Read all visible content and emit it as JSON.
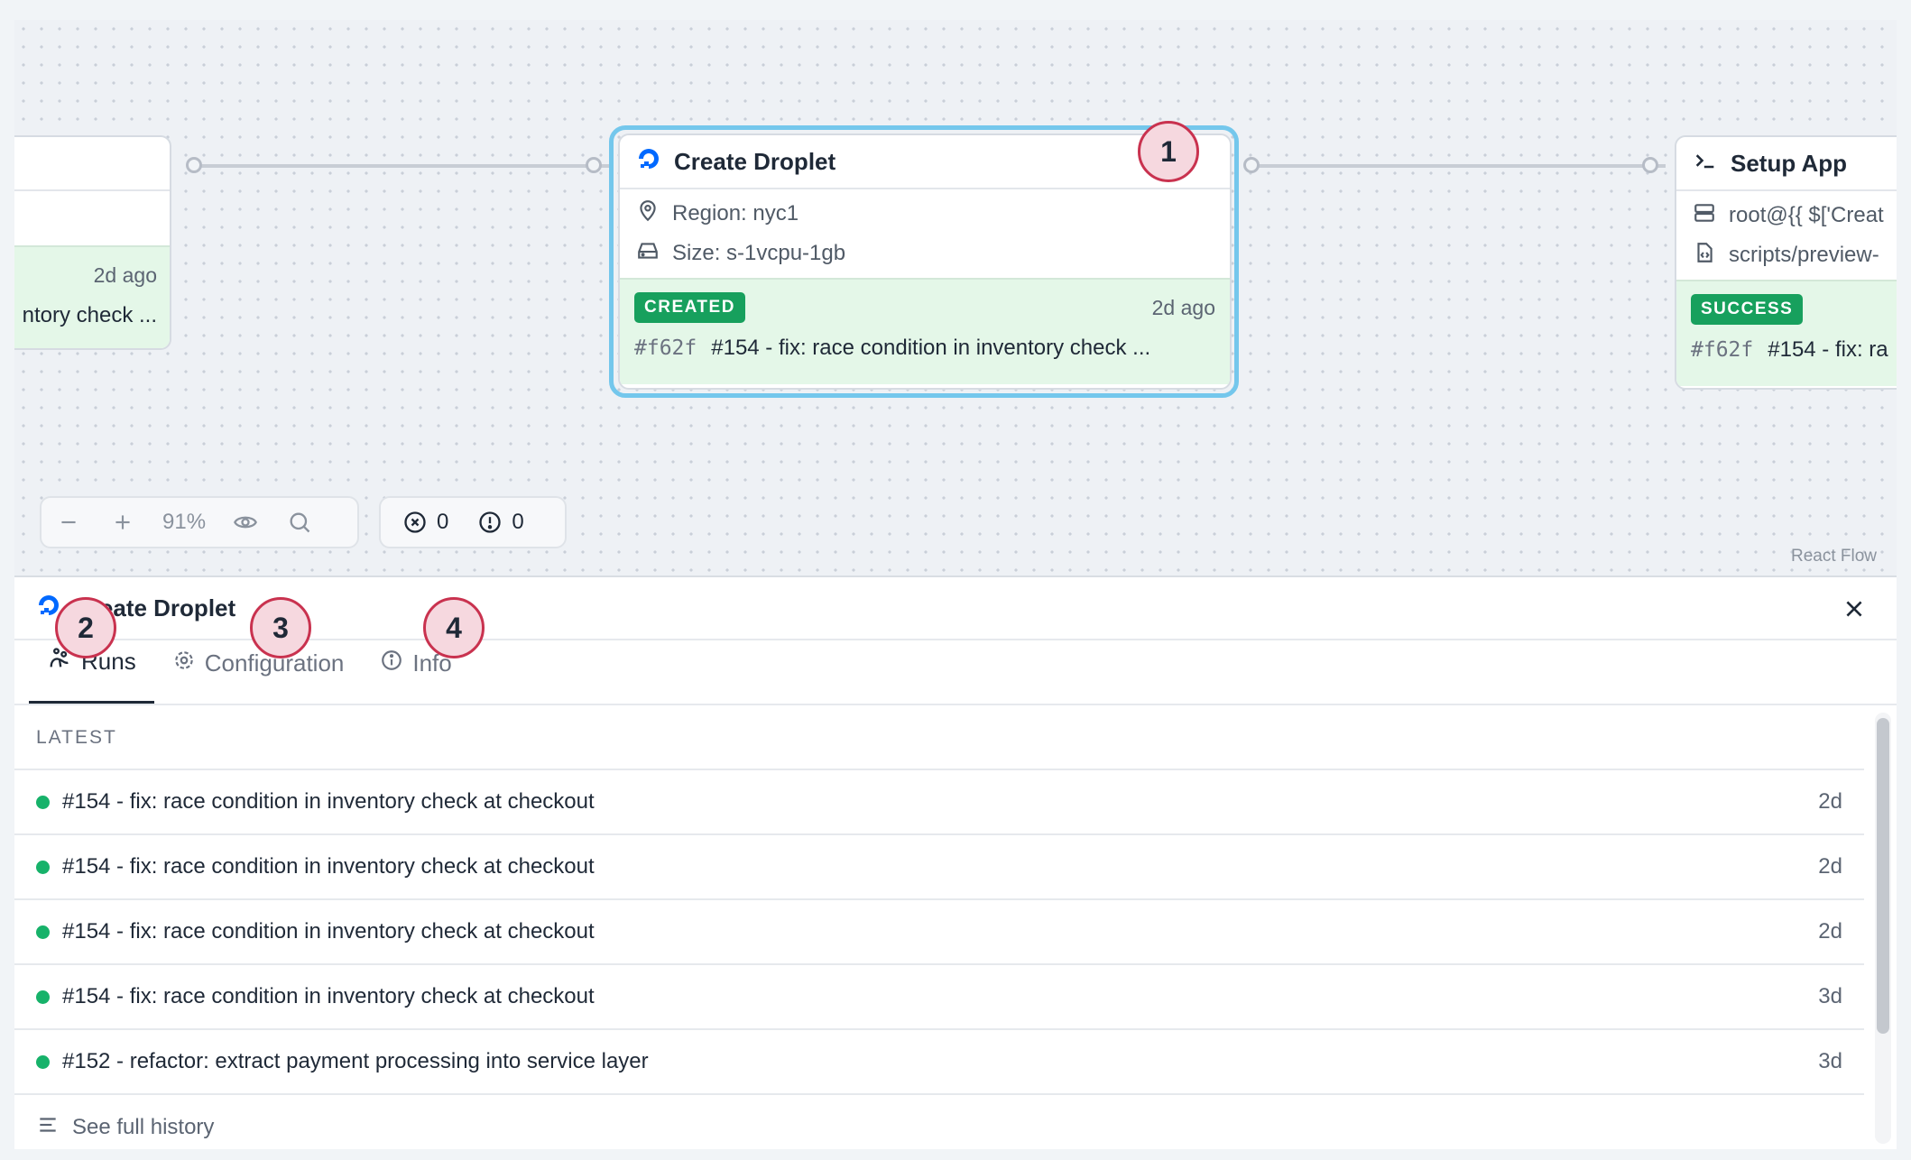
{
  "canvas": {
    "left_node": {
      "time": "2d ago",
      "commit_fragment": "ntory check ..."
    },
    "create_droplet": {
      "title": "Create Droplet",
      "region": "Region: nyc1",
      "size": "Size: s-1vcpu-1gb",
      "status": "CREATED",
      "time": "2d ago",
      "sha": "#f62f",
      "commit": "#154 - fix: race condition in inventory check ..."
    },
    "setup_app": {
      "title": "Setup App",
      "host": "root@{{ $['Creat",
      "script": "scripts/preview-",
      "status": "SUCCESS",
      "sha": "#f62f",
      "commit": "#154 - fix: ra"
    },
    "markers": {
      "m1": "1",
      "m2": "2",
      "m3": "3",
      "m4": "4"
    },
    "controls": {
      "zoom": "91%",
      "errors": "0",
      "warnings": "0"
    },
    "attribution": "React Flow"
  },
  "panel": {
    "title": "Create Droplet",
    "tabs": [
      {
        "label": "Runs",
        "icon": "runs-icon"
      },
      {
        "label": "Configuration",
        "icon": "gear-icon"
      },
      {
        "label": "Info",
        "icon": "info-icon"
      }
    ],
    "section_label": "LATEST",
    "runs": [
      {
        "title": "#154 - fix: race condition in inventory check at checkout",
        "age": "2d"
      },
      {
        "title": "#154 - fix: race condition in inventory check at checkout",
        "age": "2d"
      },
      {
        "title": "#154 - fix: race condition in inventory check at checkout",
        "age": "2d"
      },
      {
        "title": "#154 - fix: race condition in inventory check at checkout",
        "age": "3d"
      },
      {
        "title": "#152 - refactor: extract payment processing into service layer",
        "age": "3d"
      }
    ],
    "history_label": "See full history"
  },
  "colors": {
    "success": "#17a05d",
    "selected": "#74c7ec",
    "marker": "#c9324f",
    "digitalocean": "#0069ff"
  }
}
